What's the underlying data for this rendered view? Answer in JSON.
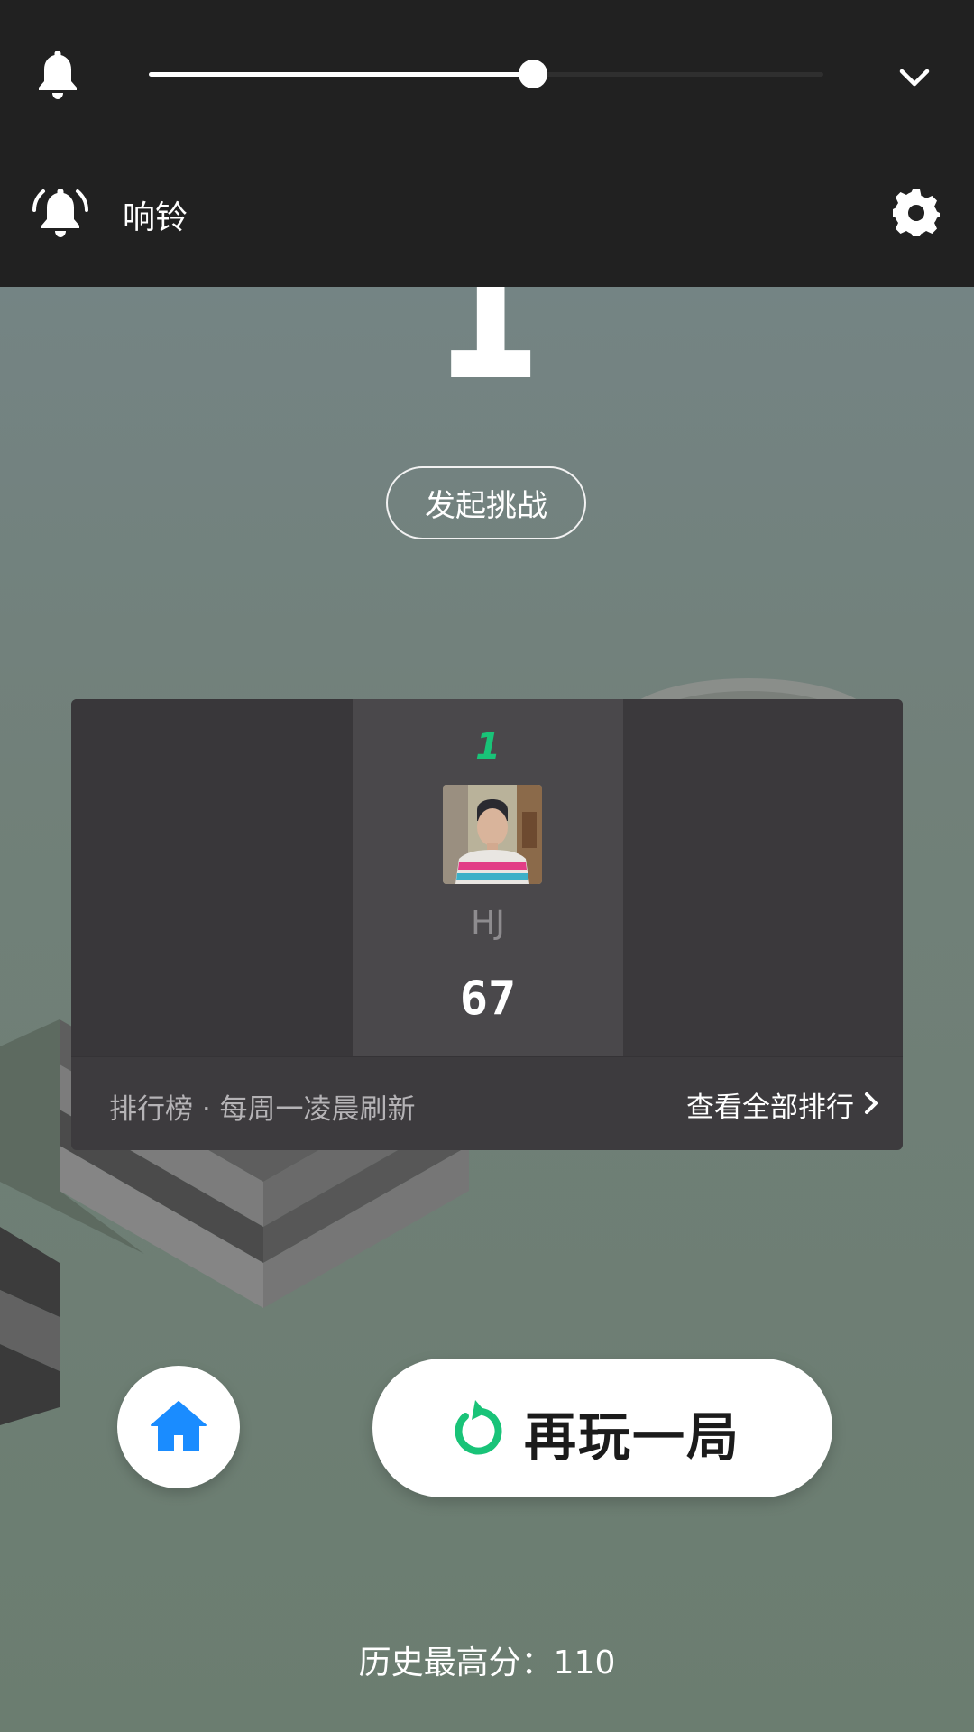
{
  "volume_panel": {
    "ringer_label": "响铃",
    "volume_level_percent": 57,
    "colors": {
      "panel": "#212121",
      "slider_fill": "#ffffff"
    }
  },
  "game": {
    "current_score": "1",
    "challenge_label": "发起挑战"
  },
  "leaderboard": {
    "entry": {
      "rank": "1",
      "name": "HJ",
      "score": "67"
    },
    "footer_left": "排行榜 · 每周一凌晨刷新",
    "footer_right": "查看全部排行",
    "colors": {
      "rank": "#19c378"
    }
  },
  "actions": {
    "replay_label": "再玩一局",
    "home_icon": "home-icon",
    "replay_icon": "replay-icon",
    "colors": {
      "home_icon": "#1a8cff",
      "replay_icon": "#19c378"
    }
  },
  "best_score_text": "历史最高分：110"
}
